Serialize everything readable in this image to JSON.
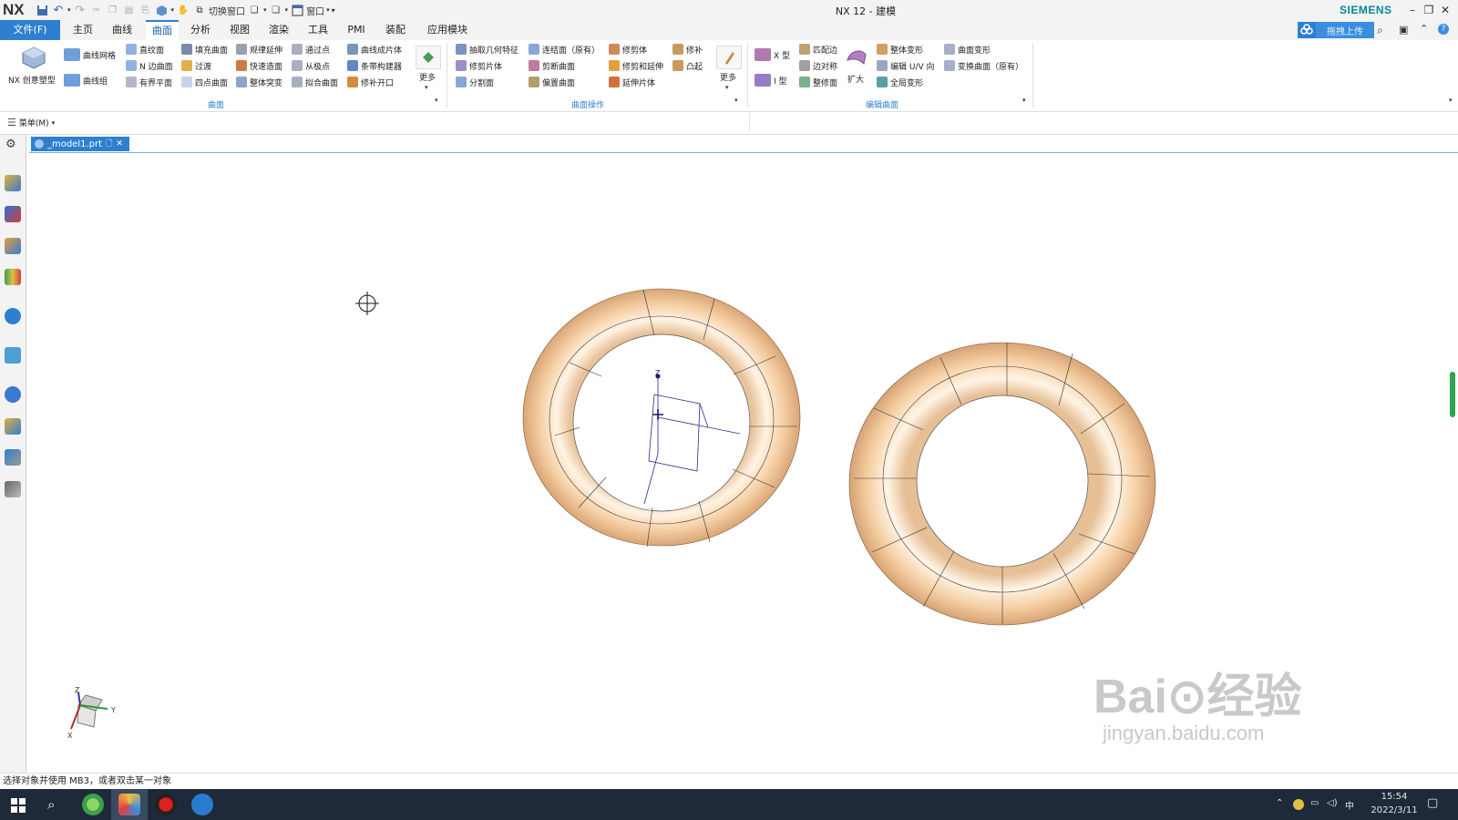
{
  "window": {
    "logo": "NX",
    "title": "NX 12 - 建模",
    "brand": "SIEMENS",
    "quick_access": {
      "switch_window": "切换窗口",
      "window_menu": "窗口"
    }
  },
  "tabs": {
    "file": "文件(F)",
    "items": [
      "主页",
      "曲线",
      "曲面",
      "分析",
      "视图",
      "渲染",
      "工具",
      "PMI",
      "装配",
      "应用模块"
    ],
    "active": "曲面",
    "upload_button": "拖拽上传"
  },
  "ribbon": {
    "groups": {
      "surface": {
        "label": "曲面",
        "big_button": "NX 创意塑型",
        "col1": [
          "曲线网格",
          "曲线组"
        ],
        "col2": [
          "直纹面",
          "N 边曲面",
          "有界平面"
        ],
        "col3": [
          "填充曲面",
          "过渡",
          "四点曲面"
        ],
        "col4": [
          "规律延伸",
          "快速造面",
          "整体突变"
        ],
        "col5": [
          "通过点",
          "从极点",
          "拟合曲面"
        ],
        "col6": [
          "曲线成片体",
          "条带构建器",
          "修补开口"
        ],
        "more": "更多"
      },
      "surface_ops": {
        "label": "曲面操作",
        "col1": [
          "抽取几何特征",
          "修剪片体",
          "分割面"
        ],
        "col2": [
          "连结面（原有）",
          "剪断曲面",
          "偏置曲面"
        ],
        "col3": [
          "修剪体",
          "修剪和延伸",
          "延伸片体"
        ],
        "col4": [
          "修补",
          "凸起"
        ],
        "more": "更多"
      },
      "edit_surface": {
        "label": "编辑曲面",
        "col1": [
          "X 型",
          "I 型"
        ],
        "col2": [
          "匹配边",
          "边对称",
          "整修面"
        ],
        "big": "扩大",
        "col3": [
          "整体变形",
          "编辑 U/V 向",
          "全局变形"
        ],
        "col4": [
          "曲面变形",
          "变换曲面（原有）"
        ]
      }
    }
  },
  "menu_strip": {
    "menu": "菜单(M)"
  },
  "document": {
    "tab_name": "_model1.prt"
  },
  "viewport": {
    "axis_labels": {
      "z": "Z",
      "y": "Y",
      "x": "X"
    },
    "watermark_main": "Bai⊙经验",
    "watermark_sub": "jingyan.baidu.com",
    "body_color": "#f5cfa3"
  },
  "status": {
    "message": "选择对象并使用 MB3，或者双击某一对象"
  },
  "taskbar": {
    "time": "15:54",
    "date": "2022/3/11",
    "ime": "中"
  }
}
